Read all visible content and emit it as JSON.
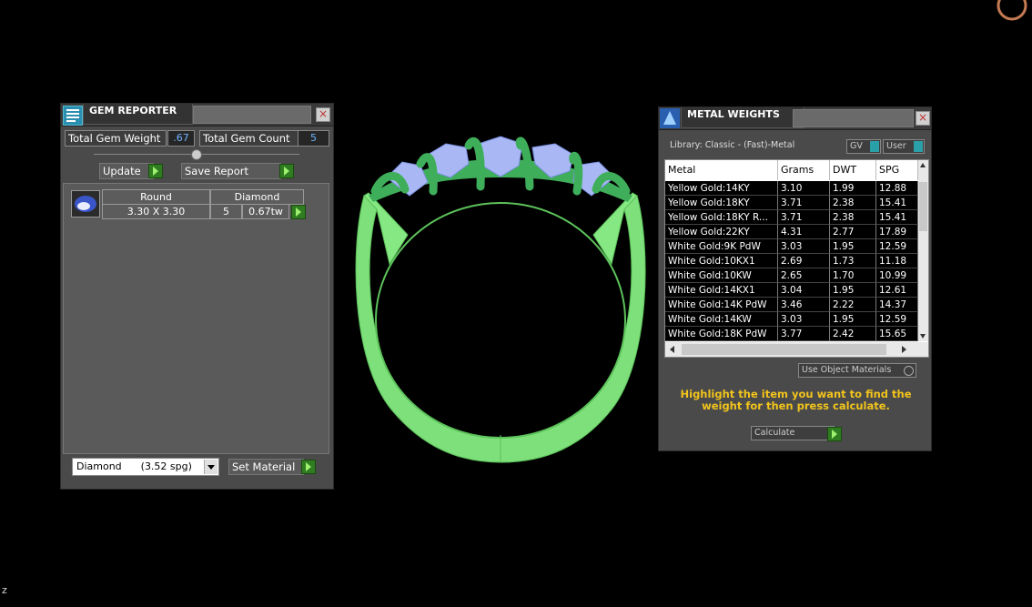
{
  "gem_reporter": {
    "title": "GEM REPORTER",
    "total_gem_weight_label": "Total Gem Weight",
    "total_gem_weight_value": ".67",
    "total_gem_count_label": "Total Gem Count",
    "total_gem_count_value": "5",
    "update_label": "Update",
    "save_report_label": "Save Report",
    "gem_row": {
      "shape": "Round",
      "material": "Diamond",
      "size": "3.30 X 3.30",
      "count": "5",
      "weight": "0.67tw"
    },
    "material_select_value": "Diamond      (3.52 spg)",
    "set_material_label": "Set Material"
  },
  "metal_weights": {
    "title": "METAL WEIGHTS",
    "library": "Library: Classic - (Fast)-Metal",
    "gv_label": "GV",
    "user_label": "User",
    "columns": [
      "Metal",
      "Grams",
      "DWT",
      "SPG"
    ],
    "rows": [
      [
        "Yellow Gold:14KY",
        "3.10",
        "1.99",
        "12.88"
      ],
      [
        "Yellow Gold:18KY",
        "3.71",
        "2.38",
        "15.41"
      ],
      [
        "Yellow Gold:18KY R...",
        "3.71",
        "2.38",
        "15.41"
      ],
      [
        "Yellow Gold:22KY",
        "4.31",
        "2.77",
        "17.89"
      ],
      [
        "White Gold:9K PdW",
        "3.03",
        "1.95",
        "12.59"
      ],
      [
        "White Gold:10KX1",
        "2.69",
        "1.73",
        "11.18"
      ],
      [
        "White Gold:10KW",
        "2.65",
        "1.70",
        "10.99"
      ],
      [
        "White Gold:14KX1",
        "3.04",
        "1.95",
        "12.61"
      ],
      [
        "White Gold:14K PdW",
        "3.46",
        "2.22",
        "14.37"
      ],
      [
        "White Gold:14KW",
        "3.03",
        "1.95",
        "12.59"
      ],
      [
        "White Gold:18K PdW",
        "3.77",
        "2.42",
        "15.65"
      ]
    ],
    "use_object_materials_label": "Use Object Materials",
    "hint": "Highlight the item you want to find the weight for then press calculate.",
    "calculate_label": "Calculate"
  },
  "status_char": "z",
  "colors": {
    "ring": "#7ee07a",
    "ring_dark": "#3fae5a",
    "gems": "#a9b8f5",
    "hint": "#f2c41c",
    "background": "#000000"
  }
}
